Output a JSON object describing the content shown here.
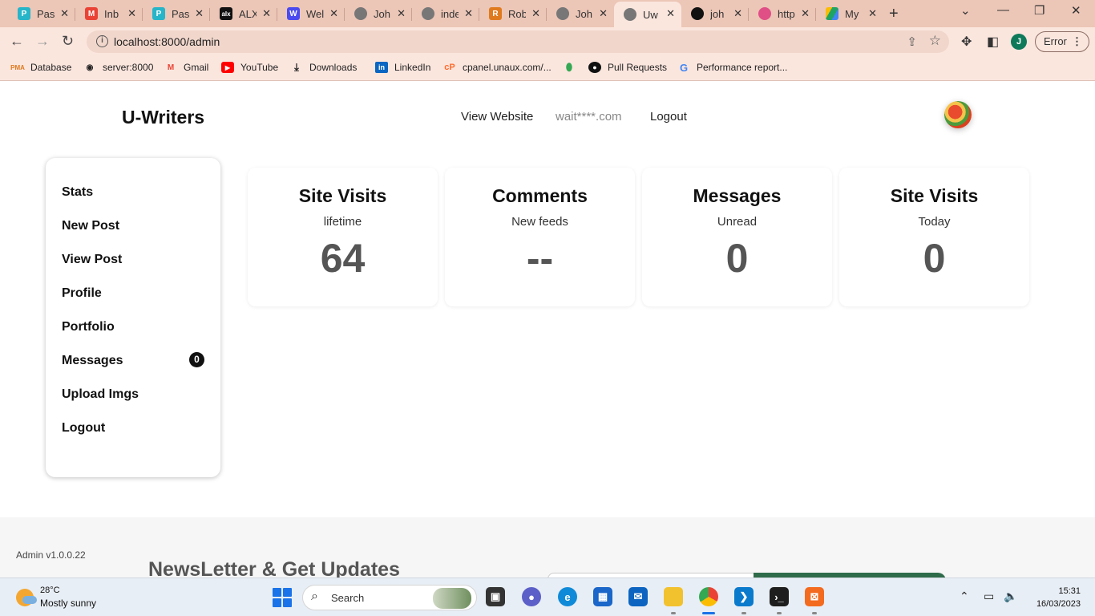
{
  "browser": {
    "tabs": [
      {
        "icon": "p-icon",
        "title": "Pas",
        "color": "#26b5c9"
      },
      {
        "icon": "gmail-icon",
        "title": "Inb",
        "color": "#ea4335"
      },
      {
        "icon": "p-icon",
        "title": "Pas",
        "color": "#26b5c9"
      },
      {
        "icon": "alx-icon",
        "title": "ALX",
        "color": "#111111"
      },
      {
        "icon": "w-icon",
        "title": "Wel",
        "color": "#4a4af0"
      },
      {
        "icon": "globe-icon",
        "title": "Joh",
        "color": "#555555"
      },
      {
        "icon": "globe-icon",
        "title": "inde",
        "color": "#555555"
      },
      {
        "icon": "robot-icon",
        "title": "Rob",
        "color": "#e07a1f"
      },
      {
        "icon": "globe-icon",
        "title": "Joh",
        "color": "#555555"
      },
      {
        "icon": "globe-icon",
        "title": "Uw",
        "color": "#555555"
      },
      {
        "icon": "github-icon",
        "title": "joh",
        "color": "#111111"
      },
      {
        "icon": "dribbble-icon",
        "title": "http",
        "color": "#e04f86"
      },
      {
        "icon": "drive-icon",
        "title": "My",
        "color": "#1fa463"
      }
    ],
    "url": "localhost:8000/admin",
    "profile_initial": "J",
    "error_label": "Error",
    "bookmarks": [
      {
        "label": "Database",
        "icon": "pma-icon"
      },
      {
        "label": "server:8000",
        "icon": "globe-icon"
      },
      {
        "label": "Gmail",
        "icon": "gmail-icon"
      },
      {
        "label": "YouTube",
        "icon": "youtube-icon"
      },
      {
        "label": "Downloads",
        "icon": "download-icon"
      },
      {
        "label": "LinkedIn",
        "icon": "linkedin-icon"
      },
      {
        "label": "cpanel.unaux.com/...",
        "icon": "cpanel-icon"
      },
      {
        "label": "",
        "icon": "maps-icon"
      },
      {
        "label": "Pull Requests",
        "icon": "github-icon"
      },
      {
        "label": "Performance report...",
        "icon": "google-icon"
      }
    ]
  },
  "site": {
    "brand": "U-Writers",
    "nav": {
      "view_website": "View Website",
      "email": "wait****.com",
      "logout": "Logout"
    }
  },
  "sidebar": {
    "items": [
      "Stats",
      "New Post",
      "View Post",
      "Profile",
      "Portfolio",
      "Messages",
      "Upload Imgs",
      "Logout"
    ],
    "messages_badge": "0"
  },
  "cards": [
    {
      "title": "Site Visits",
      "subtitle": "lifetime",
      "value": "64"
    },
    {
      "title": "Comments",
      "subtitle": "New feeds",
      "value": "--"
    },
    {
      "title": "Messages",
      "subtitle": "Unread",
      "value": "0"
    },
    {
      "title": "Site Visits",
      "subtitle": "Today",
      "value": "0"
    }
  ],
  "footer": {
    "version": "Admin v1.0.0.22",
    "newsletter_title": "NewsLetter & Get Updates"
  },
  "taskbar": {
    "temperature": "28°C",
    "condition": "Mostly sunny",
    "search_placeholder": "Search",
    "time": "15:31",
    "date": "16/03/2023"
  }
}
